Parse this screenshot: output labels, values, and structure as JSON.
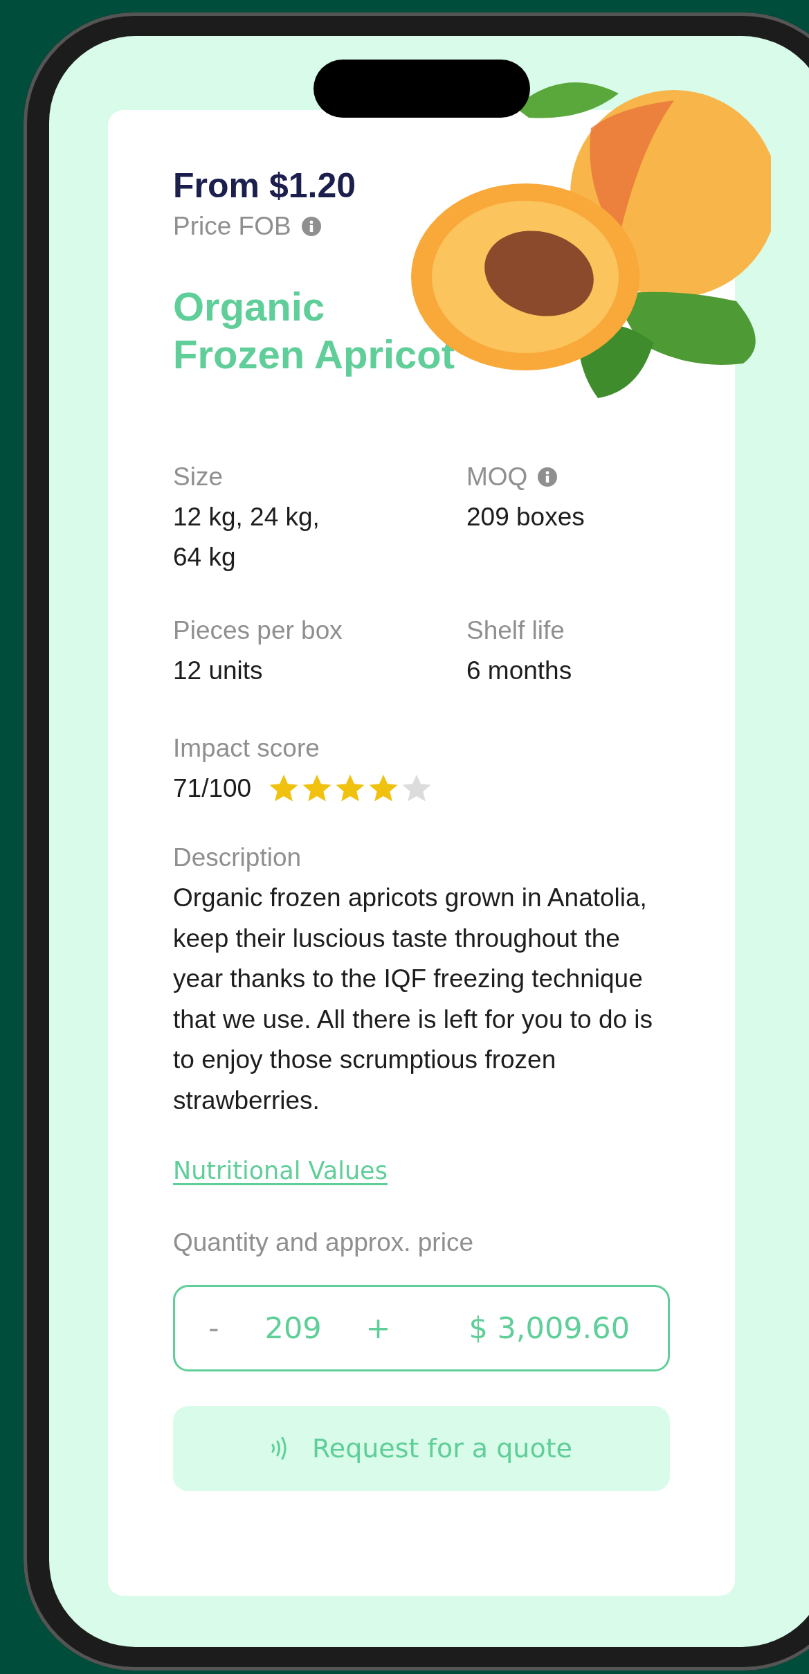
{
  "price": {
    "amount": "From $1.20",
    "label": "Price FOB",
    "info": true
  },
  "title": "Organic Frozen Apricot",
  "specs": [
    {
      "label": "Size",
      "value": "12 kg, 24 kg, 64 kg",
      "info": false
    },
    {
      "label": "MOQ",
      "value": "209 boxes",
      "info": true
    },
    {
      "label": "Pieces per box",
      "value": "12 units",
      "info": false
    },
    {
      "label": "Shelf life",
      "value": "6 months",
      "info": false
    }
  ],
  "impact": {
    "label": "Impact score",
    "score": "71/100",
    "stars": 4
  },
  "description": {
    "label": "Description",
    "text": "Organic frozen apricots grown in Anatolia, keep their luscious taste throughout the year thanks to the IQF freezing technique that we use. All there is left for you to do is to enjoy those scrumptious frozen strawberries."
  },
  "link": "Nutritional Values",
  "quantity": {
    "label": "Quantity and approx. price",
    "decrement": "-",
    "decrement_disabled": true,
    "value": "209",
    "increment": "+",
    "total": "$ 3,009.60"
  },
  "cta": "Request for a quote"
}
